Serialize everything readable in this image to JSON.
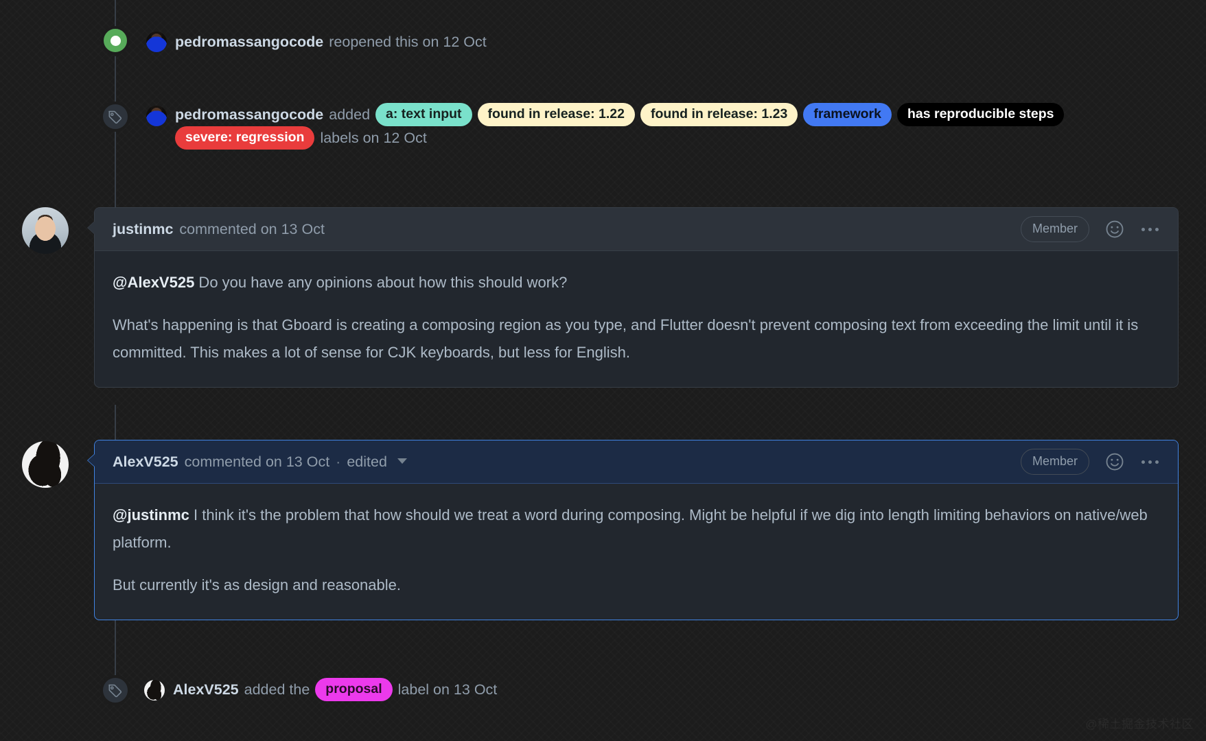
{
  "theme": {
    "page_bg": "#1c1c1c",
    "comment_bg": "#22272e",
    "comment_header_bg": "#2d333b",
    "border": "#373e47",
    "highlight_border": "#4184e4",
    "highlight_header_bg": "#1c2b45",
    "text": "#adbac7",
    "muted_text": "#909dab",
    "strong_text": "#cdd9e5",
    "reopen_green": "#57ab5a"
  },
  "timeline": {
    "reopen_event": {
      "icon": "reopened-issue-icon",
      "avatar": "pedromassangocode-avatar",
      "user": "pedromassangocode",
      "action": "reopened this on 12 Oct"
    },
    "labels_added_event": {
      "icon": "tag-icon",
      "avatar": "pedromassangocode-avatar",
      "user": "pedromassangocode",
      "action_prefix": "added",
      "action_suffix": "labels on 12 Oct",
      "labels": [
        {
          "name": "a: text input",
          "bg": "#7ae1cb",
          "fg": "#16211f"
        },
        {
          "name": "found in release: 1.22",
          "bg": "#fef3c8",
          "fg": "#16211f"
        },
        {
          "name": "found in release: 1.23",
          "bg": "#fef3c8",
          "fg": "#16211f"
        },
        {
          "name": "framework",
          "bg": "#4279f3",
          "fg": "#0b1220"
        },
        {
          "name": "has reproducible steps",
          "bg": "#000000",
          "fg": "#ffffff"
        },
        {
          "name": "severe: regression",
          "bg": "#e93c3c",
          "fg": "#ffffff"
        }
      ]
    },
    "proposal_event": {
      "icon": "tag-icon",
      "avatar": "alexv525-avatar",
      "user": "AlexV525",
      "action_prefix": "added the",
      "action_suffix": "label on 13 Oct",
      "label": {
        "name": "proposal",
        "bg": "#ec3aec",
        "fg": "#2a0a2a"
      }
    }
  },
  "comments": [
    {
      "id": "justinmc-comment",
      "avatar": "justinmc-avatar",
      "author": "justinmc",
      "meta": "commented on 13 Oct",
      "edited": "",
      "association_badge": "Member",
      "reaction_icon": "smiley-icon",
      "menu_icon": "kebab-menu-icon",
      "highlighted": false,
      "paragraphs": [
        {
          "mention": "@AlexV525",
          "text": " Do you have any opinions about how this should work?"
        },
        {
          "mention": "",
          "text": "What's happening is that Gboard is creating a composing region as you type, and Flutter doesn't prevent composing text from exceeding the limit until it is committed. This makes a lot of sense for CJK keyboards, but less for English."
        }
      ]
    },
    {
      "id": "alexv525-comment",
      "avatar": "alexv525-avatar",
      "author": "AlexV525",
      "meta": "commented on 13 Oct",
      "separator": "·",
      "edited": "edited",
      "edited_caret_icon": "chevron-down-icon",
      "association_badge": "Member",
      "reaction_icon": "smiley-icon",
      "menu_icon": "kebab-menu-icon",
      "highlighted": true,
      "paragraphs": [
        {
          "mention": "@justinmc",
          "text": " I think it's the problem that how should we treat a word during composing. Might be helpful if we dig into length limiting behaviors on native/web platform."
        },
        {
          "mention": "",
          "text": "But currently it's as design and reasonable."
        }
      ]
    }
  ],
  "watermark": "@稀土掘金技术社区"
}
